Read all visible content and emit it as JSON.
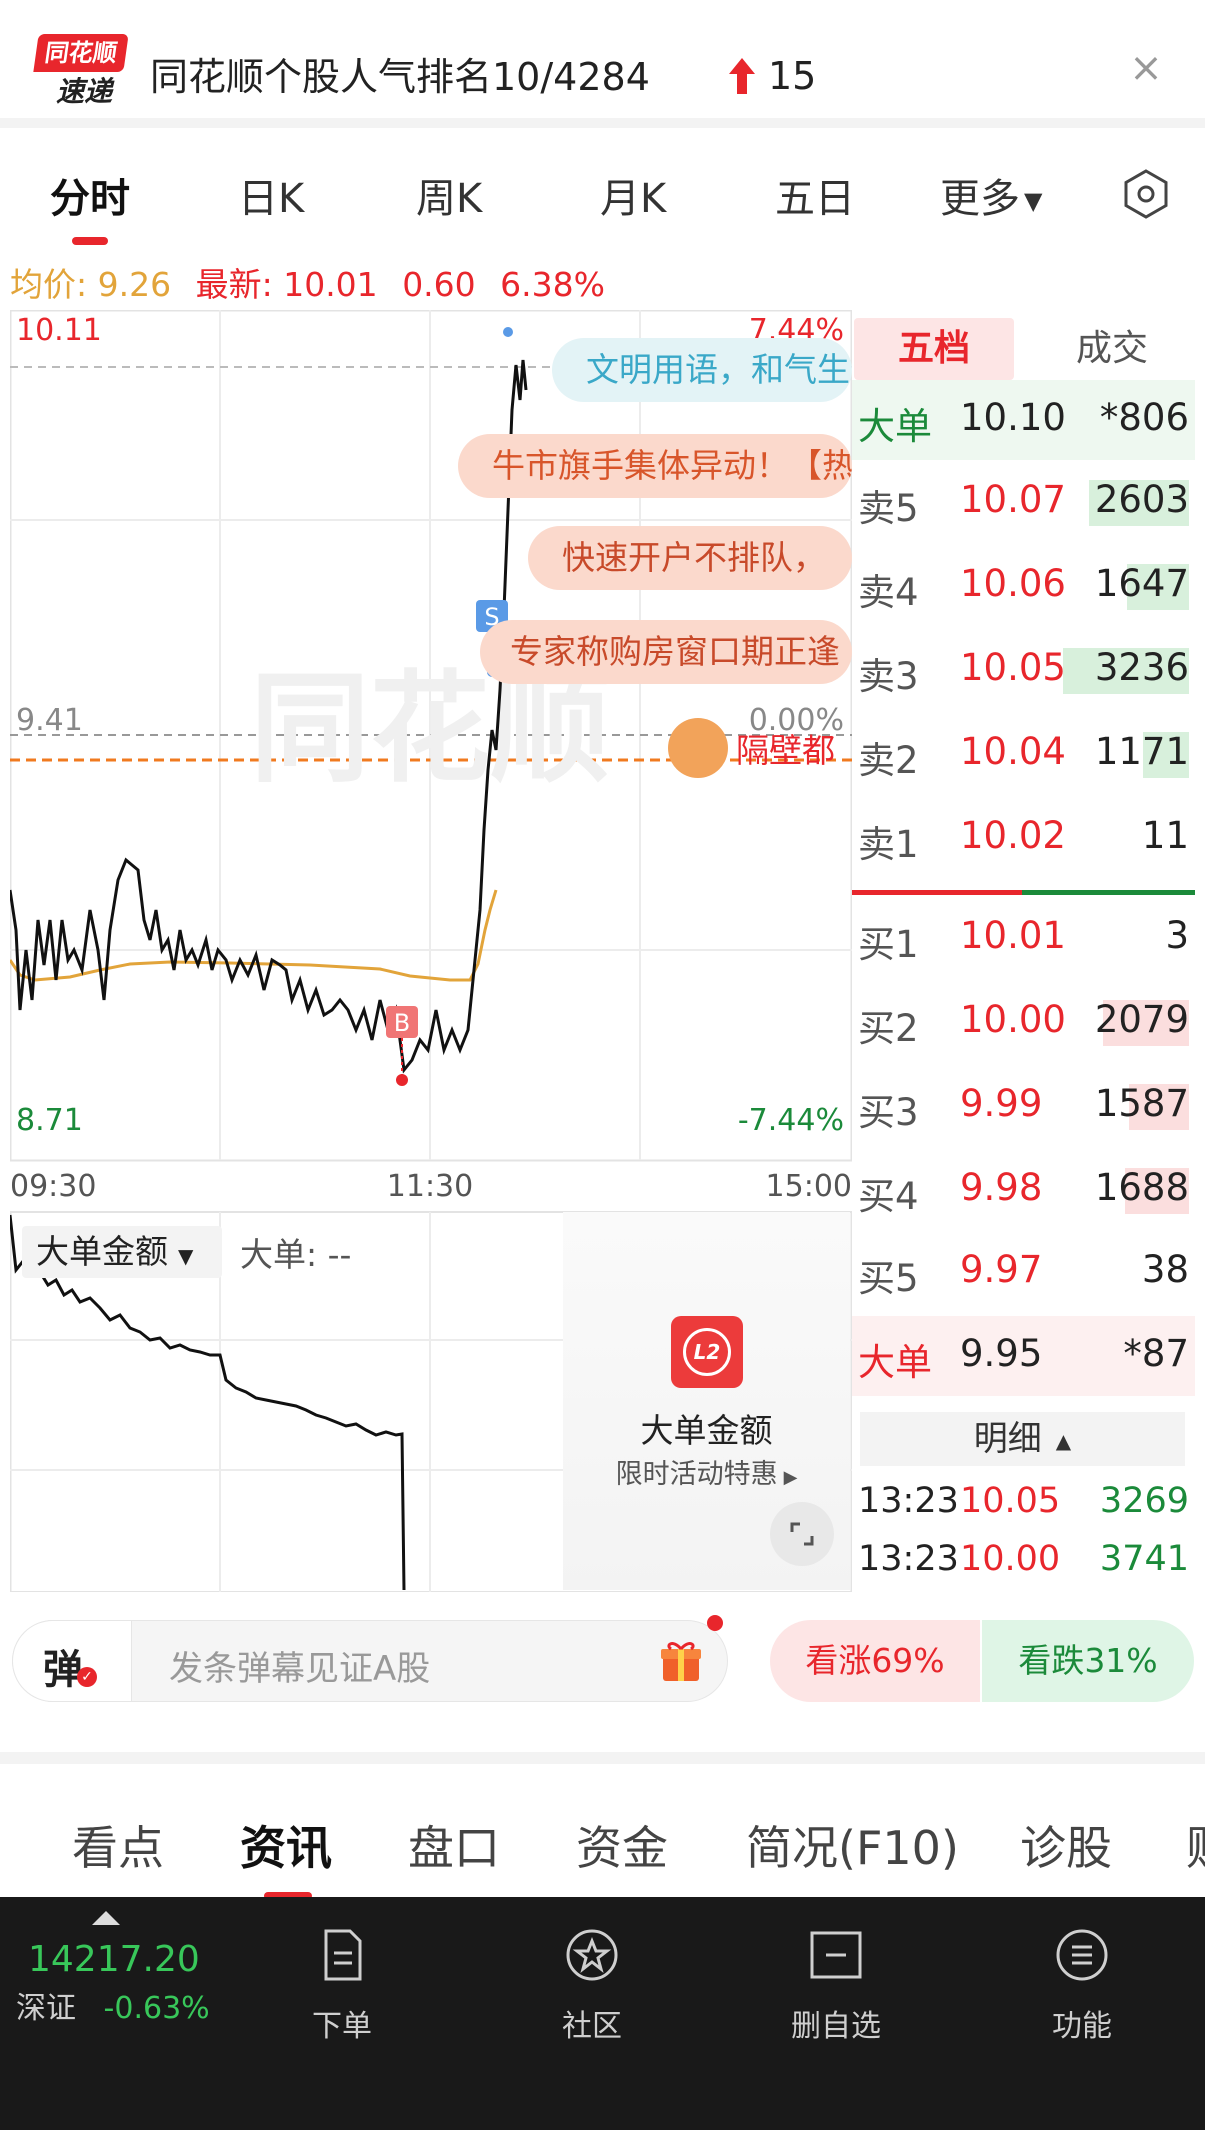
{
  "banner": {
    "logo_line1": "同花顺",
    "logo_line2": "速递",
    "title": "同花顺个股人气排名10/4284",
    "rank_change": "15"
  },
  "tabs": [
    "分时",
    "日K",
    "周K",
    "月K",
    "五日",
    "更多"
  ],
  "price_info": {
    "avg": "均价: 9.26",
    "latest": "最新: 10.01",
    "change": "0.60",
    "pct": "6.38%"
  },
  "chart": {
    "y_top": "10.11",
    "y_prev": "9.41",
    "y_bottom": "8.71",
    "pct_top": "7.44%",
    "pct_mid": "0.00%",
    "pct_bottom": "-7.44%",
    "times": [
      "09:30",
      "11:30",
      "15:00"
    ],
    "watermark": "同花顺",
    "marker_b": "B",
    "marker_s": "S"
  },
  "bubbles": [
    "文明用语，和气生",
    "牛市旗手集体异动！【热",
    "快速开户不排队，",
    "专家称购房窗口期正逢",
    "隔壁都"
  ],
  "book": {
    "tab_active": "五档",
    "tab_other": "成交",
    "rows": [
      {
        "label": "大单",
        "price": "10.10",
        "vol": "*806",
        "type": "big-sell"
      },
      {
        "label": "卖5",
        "price": "10.07",
        "vol": "2603",
        "type": "sell"
      },
      {
        "label": "卖4",
        "price": "10.06",
        "vol": "1647",
        "type": "sell"
      },
      {
        "label": "卖3",
        "price": "10.05",
        "vol": "3236",
        "type": "sell"
      },
      {
        "label": "卖2",
        "price": "10.04",
        "vol": "1171",
        "type": "sell"
      },
      {
        "label": "卖1",
        "price": "10.02",
        "vol": "11",
        "type": "sell"
      },
      {
        "label": "买1",
        "price": "10.01",
        "vol": "3",
        "type": "buy"
      },
      {
        "label": "买2",
        "price": "10.00",
        "vol": "2079",
        "type": "buy"
      },
      {
        "label": "买3",
        "price": "9.99",
        "vol": "1587",
        "type": "buy"
      },
      {
        "label": "买4",
        "price": "9.98",
        "vol": "1688",
        "type": "buy"
      },
      {
        "label": "买5",
        "price": "9.97",
        "vol": "38",
        "type": "buy"
      },
      {
        "label": "大单",
        "price": "9.95",
        "vol": "*87",
        "type": "big-buy"
      }
    ],
    "detail_label": "明细",
    "details": [
      {
        "time": "13:23",
        "price": "10.05",
        "vol": "3269"
      },
      {
        "time": "13:23",
        "price": "10.00",
        "vol": "3741"
      }
    ]
  },
  "sub_chart": {
    "selector": "大单金额",
    "label": "大单: --",
    "promo_title": "大单金额",
    "promo_sub": "限时活动特惠",
    "promo_badge": "L2"
  },
  "danmaku": {
    "button": "弹",
    "placeholder": "发条弹幕见证A股",
    "vote_up": "看涨69%",
    "vote_down": "看跌31%"
  },
  "news_tabs": [
    "看点",
    "资讯",
    "盘口",
    "资金",
    "简况(F10)",
    "诊股",
    "财"
  ],
  "bottom": {
    "index_value": "14217.20",
    "index_name": "深证",
    "index_change": "-0.63%",
    "nav": [
      "下单",
      "社区",
      "删自选",
      "功能"
    ]
  },
  "colors": {
    "red": "#e8262c",
    "green": "#1b8a3a",
    "avg_line": "#e2a43a",
    "orange_dash": "#f07a1f"
  }
}
